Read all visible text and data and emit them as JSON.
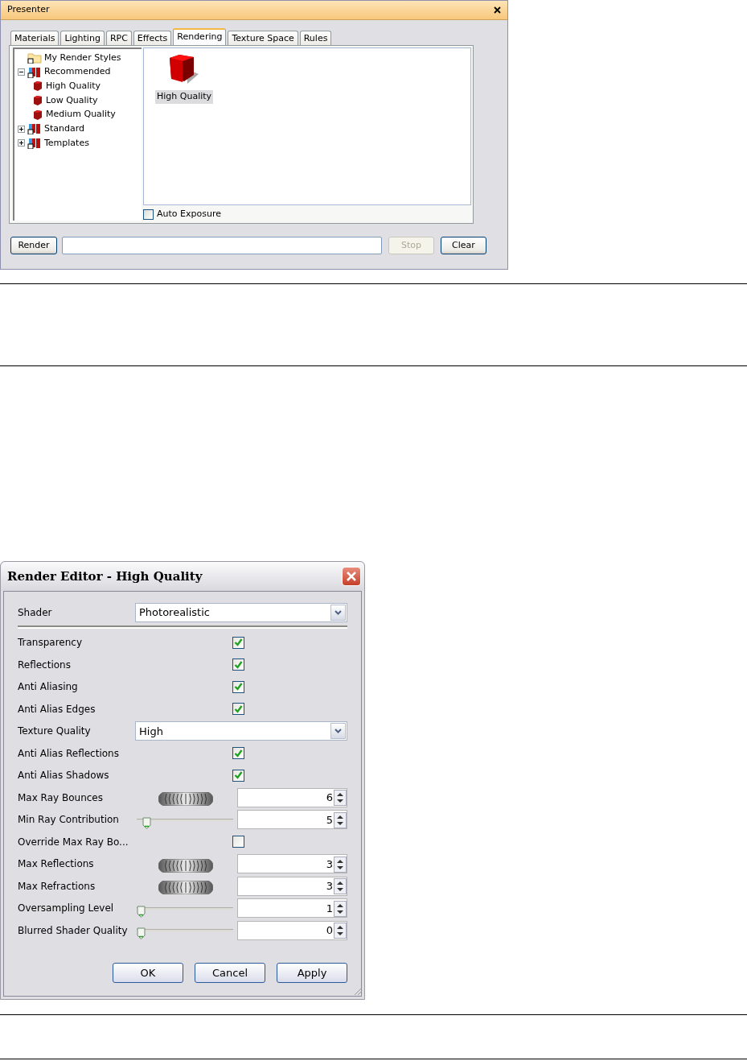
{
  "presenter": {
    "title": "Presenter",
    "tabs": [
      {
        "label": "Materials",
        "selected": false
      },
      {
        "label": "Lighting",
        "selected": false
      },
      {
        "label": "RPC",
        "selected": false
      },
      {
        "label": "Effects",
        "selected": false
      },
      {
        "label": "Rendering",
        "selected": true
      },
      {
        "label": "Texture Space",
        "selected": false
      },
      {
        "label": "Rules",
        "selected": false
      }
    ],
    "tree": [
      {
        "label": "My Render Styles",
        "kind": "folder"
      },
      {
        "label": "Recommended",
        "kind": "library",
        "expanded": true,
        "children": [
          {
            "label": "High Quality",
            "kind": "style"
          },
          {
            "label": "Low Quality",
            "kind": "style"
          },
          {
            "label": "Medium Quality",
            "kind": "style"
          }
        ]
      },
      {
        "label": "Standard",
        "kind": "library",
        "expanded": false
      },
      {
        "label": "Templates",
        "kind": "library",
        "expanded": false
      }
    ],
    "styles": [
      {
        "label": "High Quality",
        "selected": true
      }
    ],
    "auto_exposure": {
      "label": "Auto Exposure",
      "checked": false
    },
    "buttons": [
      {
        "label": "Render",
        "disabled": false,
        "kind": "button"
      },
      {
        "kind": "field"
      },
      {
        "label": "Stop",
        "disabled": true,
        "kind": "button"
      },
      {
        "label": "Clear",
        "disabled": false,
        "kind": "button"
      }
    ]
  },
  "render_editor": {
    "title": "Render Editor - High Quality",
    "rows": [
      {
        "label": "Shader",
        "kind": "dropdown",
        "value": "Photorealistic",
        "divider": true
      },
      {
        "label": "Transparency",
        "kind": "checkbox",
        "checked": true
      },
      {
        "label": "Reflections",
        "kind": "checkbox",
        "checked": true
      },
      {
        "label": "Anti Aliasing",
        "kind": "checkbox",
        "checked": true
      },
      {
        "label": "Anti Alias Edges",
        "kind": "checkbox",
        "checked": true
      },
      {
        "label": "Texture Quality",
        "kind": "dropdown",
        "value": "High"
      },
      {
        "label": "Anti Alias Reflections",
        "kind": "checkbox",
        "checked": true
      },
      {
        "label": "Anti Alias Shadows",
        "kind": "checkbox",
        "checked": true
      },
      {
        "label": "Max Ray Bounces",
        "kind": "wheel",
        "value": "6"
      },
      {
        "label": "Min Ray Contribution",
        "kind": "slider",
        "level": 0.06,
        "value": "5"
      },
      {
        "label": "Override Max Ray Bo...",
        "kind": "checkbox",
        "checked": false
      },
      {
        "label": "Max Reflections",
        "kind": "wheel",
        "value": "3"
      },
      {
        "label": "Max Refractions",
        "kind": "wheel",
        "value": "3"
      },
      {
        "label": "Oversampling Level",
        "kind": "slider",
        "level": 0,
        "value": "1"
      },
      {
        "label": "Blurred Shader Quality",
        "kind": "slider",
        "level": 0,
        "value": "0"
      }
    ],
    "buttons": [
      "OK",
      "Cancel",
      "Apply"
    ]
  }
}
